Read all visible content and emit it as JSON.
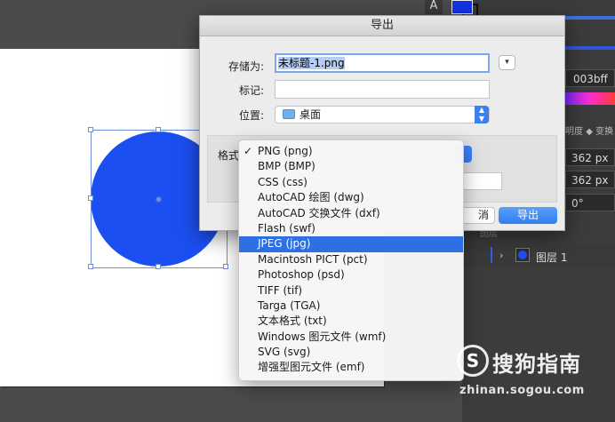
{
  "background_app": {
    "tool_icon_label": "A",
    "color_hex": "003bff",
    "properties_label": "明度",
    "properties_label2": "变换",
    "width_value": "362 px",
    "height_value": "362 px",
    "rotation_value": "0°",
    "layers_title": "图层",
    "layer_name": "图层 1"
  },
  "dialog": {
    "title": "导出",
    "save_as_label": "存储为:",
    "file_name": "未标题-1.png",
    "tags_label": "标记:",
    "tags_value": "",
    "where_label": "位置:",
    "where_value": "桌面",
    "format_label": "格式",
    "cancel_label": "消",
    "export_label": "导出"
  },
  "format_menu": {
    "selected": "PNG (png)",
    "highlighted": "JPEG (jpg)",
    "options": [
      "PNG (png)",
      "BMP (BMP)",
      "CSS (css)",
      "AutoCAD 绘图 (dwg)",
      "AutoCAD 交换文件 (dxf)",
      "Flash (swf)",
      "JPEG (jpg)",
      "Macintosh PICT (pct)",
      "Photoshop (psd)",
      "TIFF (tif)",
      "Targa (TGA)",
      "文本格式 (txt)",
      "Windows 图元文件 (wmf)",
      "SVG (svg)",
      "增强型图元文件 (emf)"
    ]
  },
  "watermark": {
    "logo_glyph": "S",
    "brand": "搜狗指南",
    "url": "zhinan.sogou.com"
  },
  "colors": {
    "shape_fill": "#1c4ff2",
    "accent": "#2f6fe4"
  }
}
